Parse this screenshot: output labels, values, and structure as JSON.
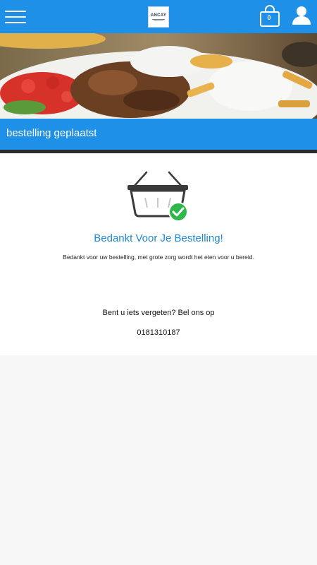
{
  "header": {
    "logo_text": "ANCAY",
    "cart_count": "0",
    "icons": [
      "menu-icon",
      "shopping-bag-icon",
      "user-icon"
    ]
  },
  "banner": {
    "title": "bestelling geplaatst"
  },
  "confirmation": {
    "heading": "Bedankt Voor Je Bestelling!",
    "message": "Bedankt voor uw bestelling, met grote zorg wordt het eten voor u bereid.",
    "forgot_text": "Bent u iets vergeten? Bel ons op",
    "phone": "0181310187",
    "icons": [
      "basket-check-icon"
    ]
  },
  "colors": {
    "primary": "#1e90e8",
    "heading": "#1e88d0",
    "success": "#2fb84a"
  }
}
